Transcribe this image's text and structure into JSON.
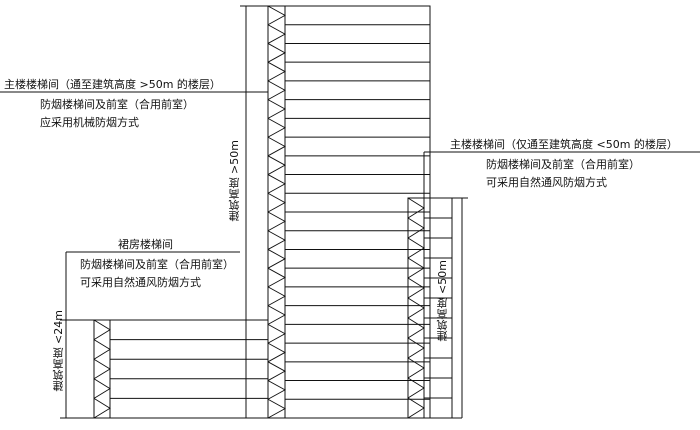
{
  "main_tower": {
    "stair_title": "主楼楼梯间（通至建筑高度 >50m 的楼层）",
    "stair_line2": "防烟楼梯间及前室（合用前室）",
    "stair_line3": "应采用机械防烟方式",
    "height_label": "建筑高度 >50m",
    "floors": 22
  },
  "secondary_tower": {
    "stair_title": "主楼楼梯间（仅通至建筑高度 <50m 的楼层）",
    "stair_line2": "防烟楼梯间及前室（合用前室）",
    "stair_line3": "可采用自然通风防烟方式",
    "height_label": "建筑高度 <50m",
    "floors": 11
  },
  "podium": {
    "stair_title": "裙房楼梯间",
    "stair_line2": "防烟楼梯间及前室（合用前室）",
    "stair_line3": "可采用自然通风防烟方式",
    "height_label": "建筑高度 <24m",
    "floors": 5
  },
  "colors": {
    "line": "#111111",
    "background": "#ffffff"
  }
}
